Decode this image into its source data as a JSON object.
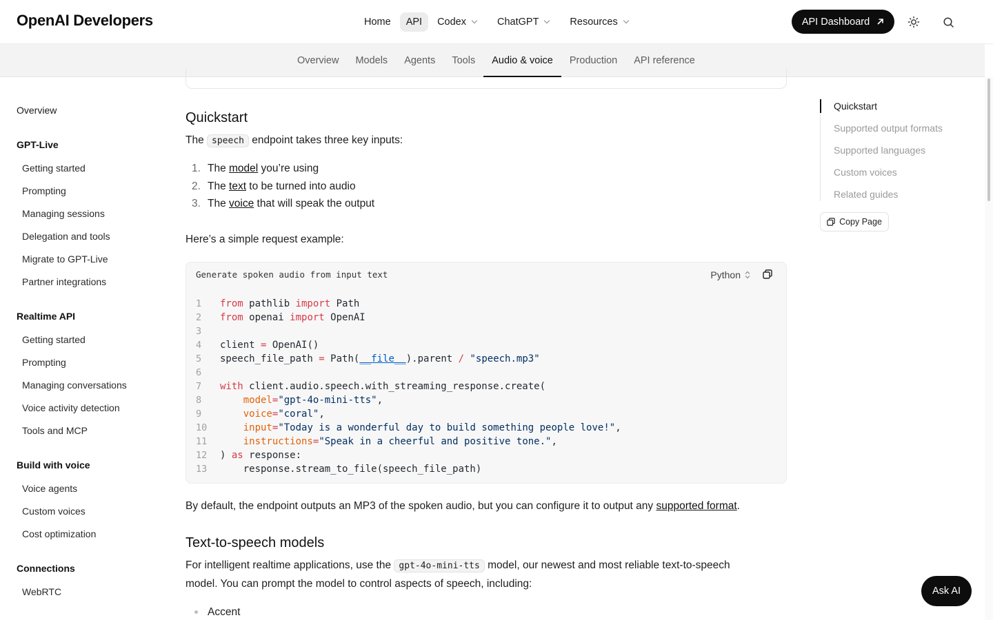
{
  "header": {
    "logo": "OpenAI Developers",
    "nav": [
      {
        "label": "Home"
      },
      {
        "label": "API"
      },
      {
        "label": "Codex"
      },
      {
        "label": "ChatGPT"
      },
      {
        "label": "Resources"
      }
    ],
    "dashboard_button": "API Dashboard"
  },
  "subnav": {
    "tabs": [
      "Overview",
      "Models",
      "Agents",
      "Tools",
      "Audio & voice",
      "Production",
      "API reference"
    ],
    "active": "Audio & voice"
  },
  "sidebar": {
    "overview": "Overview",
    "sections": [
      {
        "title": "GPT-Live",
        "items": [
          "Getting started",
          "Prompting",
          "Managing sessions",
          "Delegation and tools",
          "Migrate to GPT-Live",
          "Partner integrations"
        ]
      },
      {
        "title": "Realtime API",
        "items": [
          "Getting started",
          "Prompting",
          "Managing conversations",
          "Voice activity detection",
          "Tools and MCP"
        ]
      },
      {
        "title": "Build with voice",
        "items": [
          "Voice agents",
          "Custom voices",
          "Cost optimization"
        ]
      },
      {
        "title": "Connections",
        "items": [
          "WebRTC"
        ]
      }
    ]
  },
  "content": {
    "quickstart_heading": "Quickstart",
    "intro_pre": "The ",
    "intro_code": "speech",
    "intro_post": " endpoint takes three key inputs:",
    "inputs": [
      {
        "num": "1.",
        "pre": "The ",
        "link": "model",
        "post": " you’re using"
      },
      {
        "num": "2.",
        "pre": "The ",
        "link": "text",
        "post": " to be turned into audio"
      },
      {
        "num": "3.",
        "pre": "The ",
        "link": "voice",
        "post": " that will speak the output"
      }
    ],
    "example_intro": "Here’s a simple request example:",
    "code_title": "Generate spoken audio from input text",
    "code_language": "Python",
    "default_pre": "By default, the endpoint outputs an MP3 of the spoken audio, but you can configure it to output any ",
    "default_link": "supported format",
    "default_post": ".",
    "tts_heading": "Text-to-speech models",
    "tts_pre": "For intelligent realtime applications, use the ",
    "tts_code": "gpt-4o-mini-tts",
    "tts_post_line1": " model, our newest and most reliable text-to-speech",
    "tts_line2": "model. You can prompt the model to control aspects of speech, including:",
    "bullet_1": "Accent"
  },
  "toc": {
    "items": [
      "Quickstart",
      "Supported output formats",
      "Supported languages",
      "Custom voices",
      "Related guides"
    ],
    "active": "Quickstart",
    "copy_page": "Copy Page"
  },
  "ask_ai": "Ask AI"
}
